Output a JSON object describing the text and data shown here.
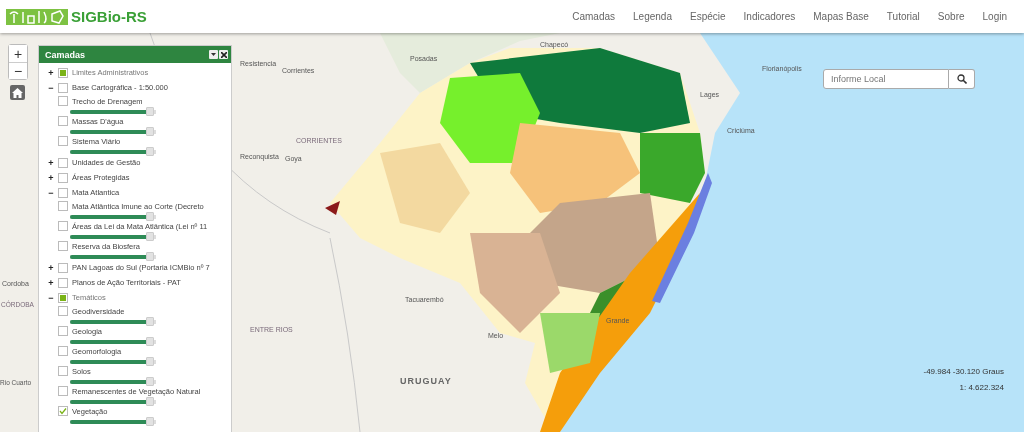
{
  "header": {
    "logo_text": "SIGBio-RS",
    "nav": [
      {
        "label": "Camadas"
      },
      {
        "label": "Legenda"
      },
      {
        "label": "Espécie"
      },
      {
        "label": "Indicadores"
      },
      {
        "label": "Mapas Base"
      },
      {
        "label": "Tutorial"
      },
      {
        "label": "Sobre"
      },
      {
        "label": "Login"
      }
    ]
  },
  "zoom_controls": {
    "zoom_in": "+",
    "zoom_out": "−"
  },
  "layers_panel": {
    "title": "Camadas",
    "layers": [
      {
        "toggle": "+",
        "label": "Limites Administrativos",
        "checked": false,
        "indeterminate": true
      },
      {
        "toggle": "−",
        "label": "Base Cartográfica - 1:50.000",
        "checked": false,
        "indeterminate": false,
        "children": [
          {
            "label": "Trecho de Drenagem",
            "checked": false,
            "level": 0.93
          },
          {
            "label": "Massas D'água",
            "checked": false,
            "level": 0.93
          },
          {
            "label": "Sistema Viário",
            "checked": false,
            "level": 0.93
          }
        ]
      },
      {
        "toggle": "+",
        "label": "Unidades de Gestão",
        "checked": false,
        "indeterminate": false
      },
      {
        "toggle": "+",
        "label": "Áreas Protegidas",
        "checked": false,
        "indeterminate": false
      },
      {
        "toggle": "−",
        "label": "Mata Atlantica",
        "checked": false,
        "indeterminate": false,
        "children": [
          {
            "label": "Mata Atlântica Imune ao Corte (Decreto",
            "checked": false,
            "level": 0.93
          },
          {
            "label": "Áreas da Lei da Mata Atlântica (Lei nº 11",
            "checked": false,
            "level": 0.93
          },
          {
            "label": "Reserva da Biosfera",
            "checked": false,
            "level": 0.93
          }
        ]
      },
      {
        "toggle": "+",
        "label": "PAN Lagoas do Sul (Portaria ICMBio nº 7",
        "checked": false,
        "indeterminate": false
      },
      {
        "toggle": "+",
        "label": "Planos de Ação Territoriais - PAT",
        "checked": false,
        "indeterminate": false
      },
      {
        "toggle": "−",
        "label": "Temáticos",
        "checked": false,
        "indeterminate": true,
        "children": [
          {
            "label": "Geodiversidade",
            "checked": false,
            "level": 0.93
          },
          {
            "label": "Geologia",
            "checked": false,
            "level": 0.93
          },
          {
            "label": "Geomorfologia",
            "checked": false,
            "level": 0.93
          },
          {
            "label": "Solos",
            "checked": false,
            "level": 0.93
          },
          {
            "label": "Remanescentes de Vegetação Natural",
            "checked": false,
            "level": 0.93
          },
          {
            "label": "Vegetação",
            "checked": true,
            "level": 0.93
          }
        ]
      }
    ]
  },
  "search": {
    "placeholder": "Informe Local"
  },
  "map_labels": [
    "Resistencia",
    "Corrientes",
    "Posadas",
    "Chapecó",
    "Lages",
    "Florianópolis",
    "Criciúma",
    "CORRIENTES",
    "Reconquista",
    "Goya",
    "Cordoba",
    "CÓRDOBA",
    "Rio Cuarto",
    "ENTRE RIOS",
    "Tacuarembó",
    "Melo",
    "URUGUAY",
    "Grande"
  ],
  "coordinates": "-49.984 -30.120 Graus",
  "scale": "1: 4.622.324"
}
